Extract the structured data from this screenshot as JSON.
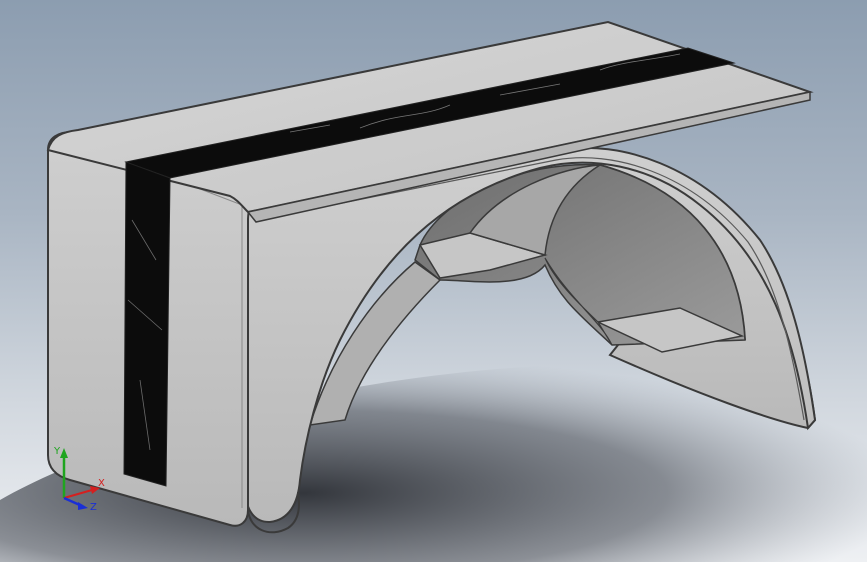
{
  "viewport": {
    "background_top": "#8c9db0",
    "background_bottom": "#eef0f3"
  },
  "model": {
    "body_color": "#c9c9c9",
    "edge_color": "#3a3a3a",
    "inlay_color": "#0c0c0c",
    "cavity_color": "#7d7d7d"
  },
  "triad": {
    "x_label": "X",
    "y_label": "Y",
    "z_label": "Z",
    "x_color": "#d42020",
    "y_color": "#1fa51f",
    "z_color": "#1a2fd6"
  }
}
